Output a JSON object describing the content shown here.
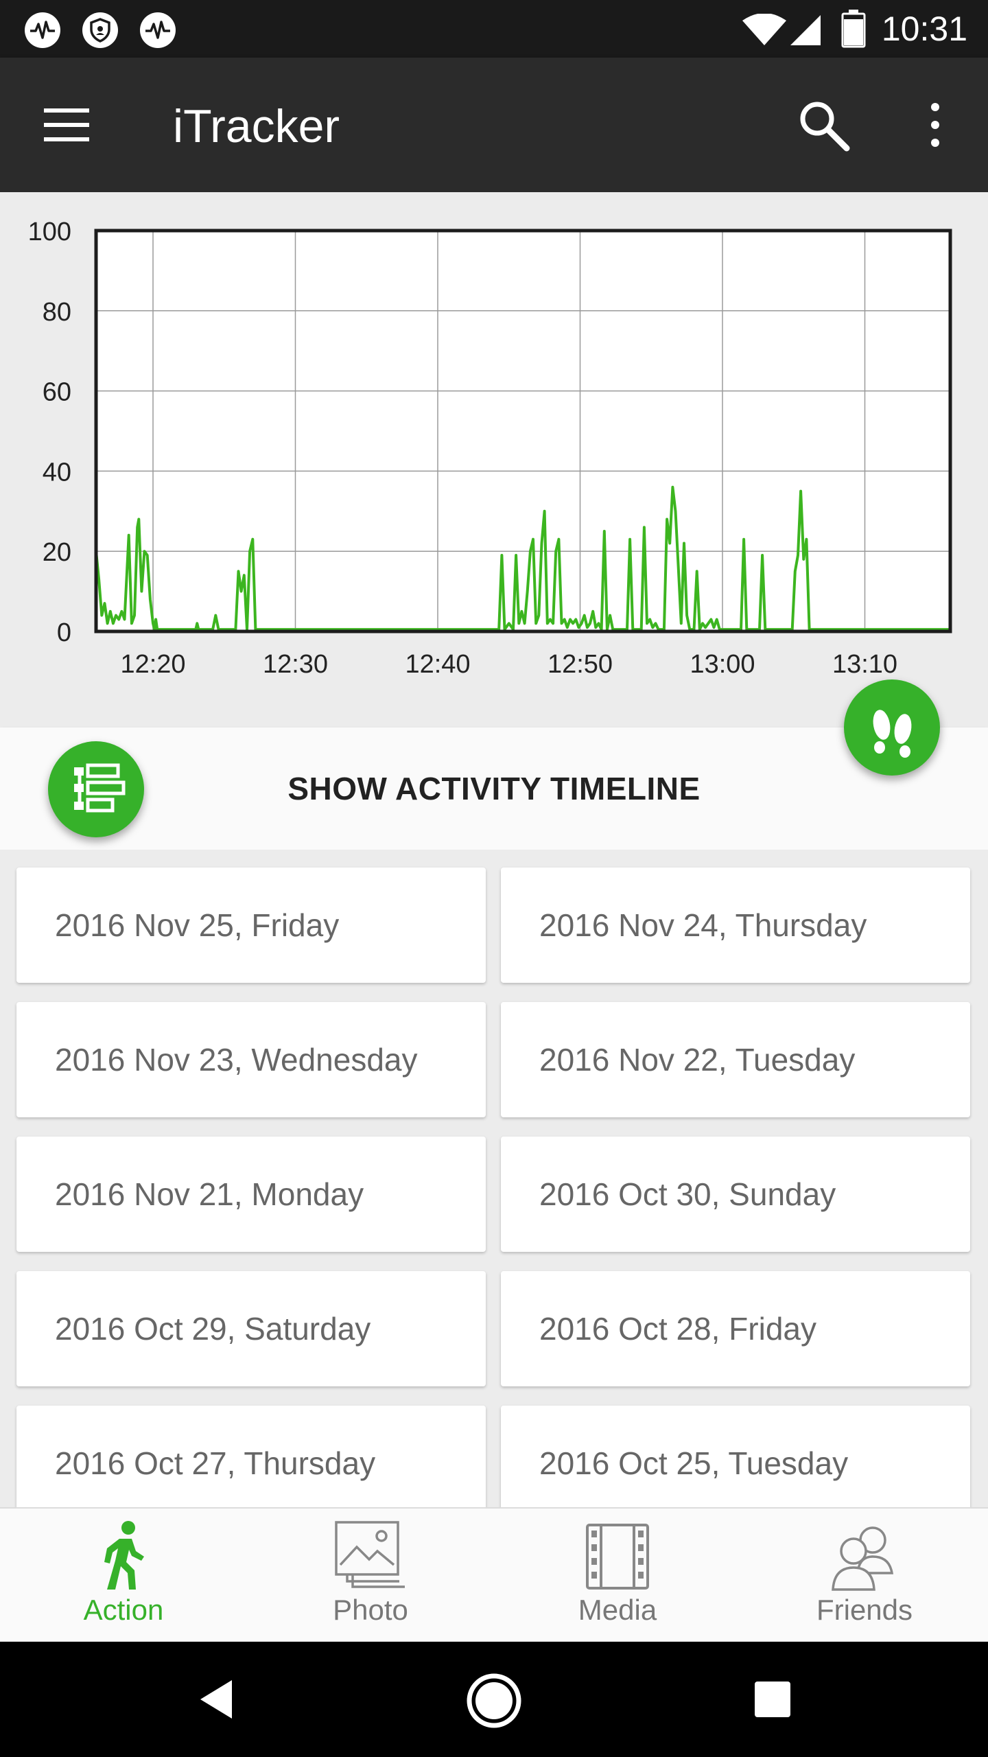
{
  "status_bar": {
    "time": "10:31",
    "icons": [
      "activity-notification-icon",
      "shield-notification-icon",
      "activity-notification-icon",
      "wifi-icon",
      "cell-signal-icon",
      "battery-icon"
    ]
  },
  "app_bar": {
    "title": "iTracker",
    "icons": [
      "menu-icon",
      "search-icon",
      "more-vert-icon"
    ]
  },
  "colors": {
    "accent": "#36b12a",
    "app_bar": "#2b2b2b",
    "status_bar": "#1a1a1a",
    "line": "#3cb51f"
  },
  "chart_data": {
    "type": "line",
    "y_ticks": [
      "0",
      "20",
      "40",
      "60",
      "80",
      "100"
    ],
    "x_ticks": [
      "12:20",
      "12:30",
      "12:40",
      "12:50",
      "13:00",
      "13:10"
    ],
    "x_tick_minutes": [
      20,
      30,
      40,
      50,
      60,
      70
    ],
    "xlim": [
      "12:16",
      "13:16"
    ],
    "ylim": [
      0,
      100
    ],
    "grid": true,
    "series": [
      {
        "color": "#3cb51f",
        "points": [
          [
            16.0,
            20
          ],
          [
            16.2,
            13
          ],
          [
            16.4,
            4
          ],
          [
            16.6,
            7
          ],
          [
            16.8,
            2
          ],
          [
            17.0,
            5
          ],
          [
            17.2,
            2
          ],
          [
            17.4,
            4
          ],
          [
            17.6,
            3
          ],
          [
            17.8,
            5
          ],
          [
            18.0,
            3
          ],
          [
            18.3,
            24
          ],
          [
            18.5,
            2
          ],
          [
            18.7,
            4
          ],
          [
            18.9,
            26
          ],
          [
            19.0,
            28
          ],
          [
            19.2,
            10
          ],
          [
            19.4,
            20
          ],
          [
            19.6,
            19
          ],
          [
            19.8,
            8
          ],
          [
            20.0,
            2
          ],
          [
            20.1,
            0.5
          ],
          [
            20.2,
            3
          ],
          [
            20.3,
            0.5
          ],
          [
            20.6,
            0.5
          ],
          [
            23.0,
            0.5
          ],
          [
            23.1,
            2
          ],
          [
            23.2,
            0.5
          ],
          [
            24.2,
            0.5
          ],
          [
            24.4,
            4
          ],
          [
            24.6,
            0.5
          ],
          [
            25.8,
            0.5
          ],
          [
            26.0,
            15
          ],
          [
            26.2,
            10
          ],
          [
            26.4,
            14
          ],
          [
            26.6,
            0.5
          ],
          [
            26.8,
            20
          ],
          [
            27.0,
            23
          ],
          [
            27.2,
            0.5
          ],
          [
            44.3,
            0.5
          ],
          [
            44.5,
            19
          ],
          [
            44.7,
            0.5
          ],
          [
            45.0,
            2
          ],
          [
            45.3,
            0.5
          ],
          [
            45.5,
            19
          ],
          [
            45.7,
            2
          ],
          [
            45.9,
            5
          ],
          [
            46.1,
            2
          ],
          [
            46.3,
            10
          ],
          [
            46.5,
            20
          ],
          [
            46.7,
            23
          ],
          [
            46.9,
            2
          ],
          [
            47.1,
            4
          ],
          [
            47.3,
            22
          ],
          [
            47.5,
            30
          ],
          [
            47.7,
            2
          ],
          [
            47.9,
            3
          ],
          [
            48.1,
            2
          ],
          [
            48.3,
            20
          ],
          [
            48.5,
            23
          ],
          [
            48.7,
            2
          ],
          [
            48.9,
            3
          ],
          [
            49.1,
            1
          ],
          [
            49.3,
            3
          ],
          [
            49.5,
            2
          ],
          [
            49.7,
            3
          ],
          [
            49.9,
            1
          ],
          [
            50.1,
            2
          ],
          [
            50.3,
            4
          ],
          [
            50.5,
            1
          ],
          [
            50.7,
            2
          ],
          [
            50.9,
            5
          ],
          [
            51.1,
            1
          ],
          [
            51.3,
            2
          ],
          [
            51.5,
            0.5
          ],
          [
            51.7,
            25
          ],
          [
            51.9,
            0.5
          ],
          [
            52.1,
            4
          ],
          [
            52.3,
            0.5
          ],
          [
            53.3,
            0.5
          ],
          [
            53.5,
            23
          ],
          [
            53.7,
            0.5
          ],
          [
            54.3,
            0.5
          ],
          [
            54.5,
            26
          ],
          [
            54.7,
            2
          ],
          [
            54.9,
            3
          ],
          [
            55.1,
            1
          ],
          [
            55.3,
            2
          ],
          [
            55.5,
            0.5
          ],
          [
            55.9,
            0.5
          ],
          [
            56.1,
            28
          ],
          [
            56.3,
            22
          ],
          [
            56.5,
            36
          ],
          [
            56.7,
            30
          ],
          [
            56.9,
            16
          ],
          [
            57.1,
            2
          ],
          [
            57.3,
            22
          ],
          [
            57.5,
            4
          ],
          [
            57.7,
            0.5
          ],
          [
            58.0,
            0.5
          ],
          [
            58.2,
            15
          ],
          [
            58.4,
            0.5
          ],
          [
            58.6,
            2
          ],
          [
            58.8,
            1
          ],
          [
            59.0,
            2
          ],
          [
            59.2,
            3
          ],
          [
            59.4,
            1
          ],
          [
            59.6,
            3
          ],
          [
            59.8,
            0.5
          ],
          [
            61.3,
            0.5
          ],
          [
            61.5,
            23
          ],
          [
            61.7,
            0.5
          ],
          [
            62.6,
            0.5
          ],
          [
            62.8,
            19
          ],
          [
            63.0,
            0.5
          ],
          [
            64.9,
            0.5
          ],
          [
            65.1,
            15
          ],
          [
            65.3,
            19
          ],
          [
            65.5,
            35
          ],
          [
            65.7,
            18
          ],
          [
            65.9,
            23
          ],
          [
            66.1,
            0.5
          ],
          [
            76.0,
            0.5
          ]
        ]
      }
    ]
  },
  "timeline": {
    "label": "SHOW ACTIVITY TIMELINE",
    "icons": [
      "timeline-icon",
      "footprints-icon"
    ]
  },
  "dates": [
    "2016 Nov 25, Friday",
    "2016 Nov 24, Thursday",
    "2016 Nov 23, Wednesday",
    "2016 Nov 22, Tuesday",
    "2016 Nov 21, Monday",
    "2016 Oct 30, Sunday",
    "2016 Oct 29, Saturday",
    "2016 Oct 28, Friday",
    "2016 Oct 27, Thursday",
    "2016 Oct 25, Tuesday"
  ],
  "bottom_nav": [
    {
      "label": "Action",
      "icon": "walking-person-icon",
      "active": true
    },
    {
      "label": "Photo",
      "icon": "photos-icon",
      "active": false
    },
    {
      "label": "Media",
      "icon": "film-strip-icon",
      "active": false
    },
    {
      "label": "Friends",
      "icon": "friends-icon",
      "active": false
    }
  ],
  "system_nav": {
    "icons": [
      "back-icon",
      "home-icon",
      "recents-icon"
    ]
  }
}
